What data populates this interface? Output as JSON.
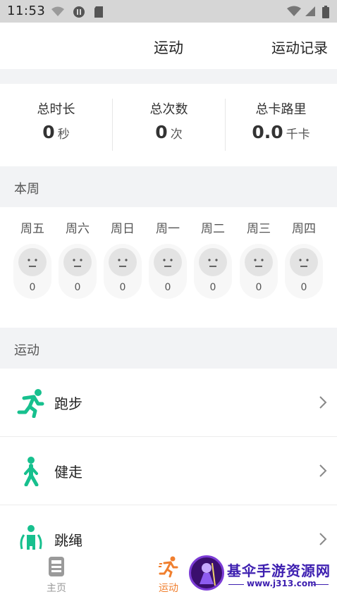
{
  "status_bar": {
    "time": "11:53"
  },
  "nav": {
    "title": "运动",
    "action": "运动记录"
  },
  "stats": [
    {
      "label": "总时长",
      "value": "0",
      "unit": "秒"
    },
    {
      "label": "总次数",
      "value": "0",
      "unit": "次"
    },
    {
      "label": "总卡路里",
      "value": "0.0",
      "unit": "千卡"
    }
  ],
  "week": {
    "title": "本周",
    "days": [
      {
        "label": "周五",
        "count": "0"
      },
      {
        "label": "周六",
        "count": "0"
      },
      {
        "label": "周日",
        "count": "0"
      },
      {
        "label": "周一",
        "count": "0"
      },
      {
        "label": "周二",
        "count": "0"
      },
      {
        "label": "周三",
        "count": "0"
      },
      {
        "label": "周四",
        "count": "0"
      }
    ]
  },
  "sports": {
    "title": "运动",
    "items": [
      {
        "label": "跑步",
        "icon": "running-icon"
      },
      {
        "label": "健走",
        "icon": "walking-icon"
      },
      {
        "label": "跳绳",
        "icon": "jump-rope-icon"
      }
    ]
  },
  "tabbar": {
    "tabs": [
      {
        "label": "主页",
        "icon": "home-icon"
      },
      {
        "label": "运动",
        "icon": "sport-icon"
      }
    ]
  },
  "watermark": {
    "title": "基伞手游资源网",
    "url": "www.j313.com"
  },
  "colors": {
    "accent": "#17c08e",
    "active_tab": "#f07f2e",
    "inactive_tab": "#999999",
    "background": "#f2f3f5"
  }
}
